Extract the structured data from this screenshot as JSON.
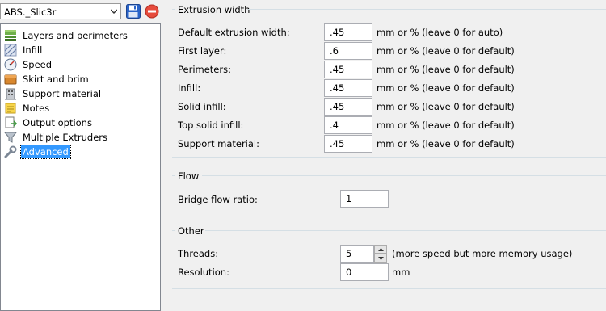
{
  "profile": {
    "selected": "ABS._Slic3r"
  },
  "toolbar": {
    "save_icon": "floppy-disk-icon",
    "delete_icon": "red-delete-icon"
  },
  "tree": {
    "items": [
      {
        "label": "Layers and perimeters",
        "icon": "layers-icon"
      },
      {
        "label": "Infill",
        "icon": "infill-icon"
      },
      {
        "label": "Speed",
        "icon": "speedometer-icon"
      },
      {
        "label": "Skirt and brim",
        "icon": "box-icon"
      },
      {
        "label": "Support material",
        "icon": "building-icon"
      },
      {
        "label": "Notes",
        "icon": "note-icon"
      },
      {
        "label": "Output options",
        "icon": "output-icon"
      },
      {
        "label": "Multiple Extruders",
        "icon": "funnel-icon"
      },
      {
        "label": "Advanced",
        "icon": "wrench-icon"
      }
    ],
    "selected": "Advanced"
  },
  "extrusion": {
    "title": "Extrusion width",
    "fields": [
      {
        "label": "Default extrusion width:",
        "value": ".45",
        "hint": "mm or % (leave 0 for auto)"
      },
      {
        "label": "First layer:",
        "value": ".6",
        "hint": "mm or % (leave 0 for default)"
      },
      {
        "label": "Perimeters:",
        "value": ".45",
        "hint": "mm or % (leave 0 for default)"
      },
      {
        "label": "Infill:",
        "value": ".45",
        "hint": "mm or % (leave 0 for default)"
      },
      {
        "label": "Solid infill:",
        "value": ".45",
        "hint": "mm or % (leave 0 for default)"
      },
      {
        "label": "Top solid infill:",
        "value": ".4",
        "hint": "mm or % (leave 0 for default)"
      },
      {
        "label": "Support material:",
        "value": ".45",
        "hint": "mm or % (leave 0 for default)"
      }
    ]
  },
  "flow": {
    "title": "Flow",
    "bridge_label": "Bridge flow ratio:",
    "bridge_value": "1"
  },
  "other": {
    "title": "Other",
    "threads_label": "Threads:",
    "threads_value": "5",
    "threads_hint": "(more speed but more memory usage)",
    "resolution_label": "Resolution:",
    "resolution_value": "0",
    "resolution_unit": "mm"
  },
  "colors": {
    "selection": "#3399ff",
    "group_rule": "#d5dfe5",
    "panel_bg": "#f0f0f0"
  }
}
